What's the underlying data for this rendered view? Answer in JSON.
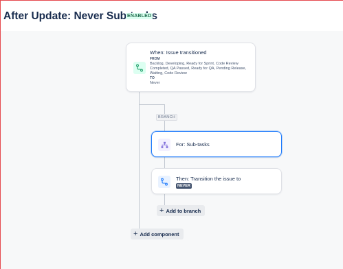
{
  "header": {
    "title": "After Update: Never Sub-tasks",
    "status": "ENABLED"
  },
  "trigger": {
    "title": "When: Issue transitioned",
    "from_label": "FROM",
    "from_value": "Backlog, Developing, Ready for Sprint, Code Review Completed, QA Passed, Ready for QA, Pending Release, Waiting, Code Review",
    "to_label": "TO",
    "to_value": "Never",
    "icon": "transition-icon"
  },
  "branch": {
    "label": "BRANCH"
  },
  "branch_condition": {
    "title": "For: Sub-tasks",
    "icon": "hierarchy-icon"
  },
  "action": {
    "title": "Then: Transition the issue to",
    "status": "NEVER",
    "icon": "transition-icon"
  },
  "buttons": {
    "add_to_branch": "Add to branch",
    "add_component": "Add component"
  },
  "colors": {
    "accent": "#1d7afc",
    "enabled": "#216e4e",
    "line": "#c1c7d0"
  }
}
